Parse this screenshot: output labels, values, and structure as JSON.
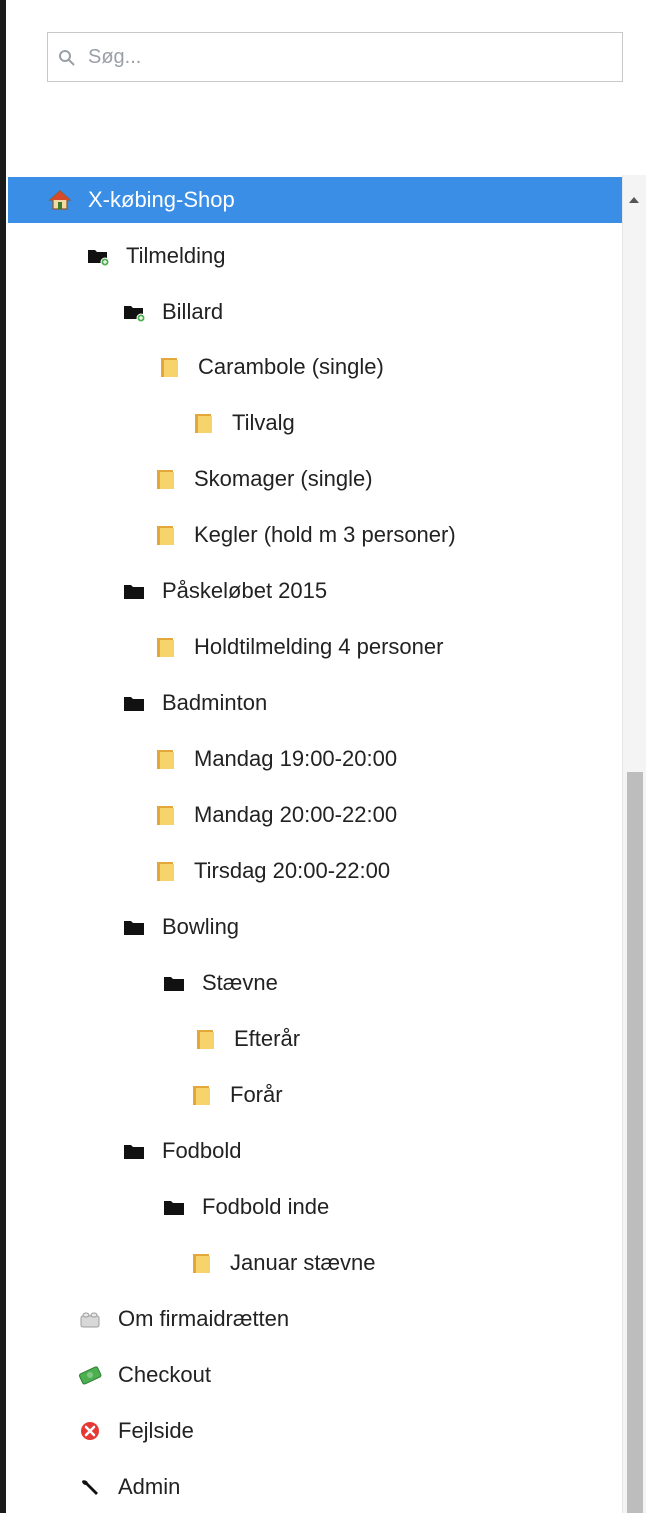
{
  "search": {
    "placeholder": "Søg..."
  },
  "tree": {
    "items": [
      {
        "label": "X-købing-Shop",
        "icon": "home-icon",
        "selected": true
      },
      {
        "label": "Tilmelding",
        "icon": "folder-add-icon"
      },
      {
        "label": "Billard",
        "icon": "folder-add-icon"
      },
      {
        "label": "Carambole (single)",
        "icon": "folder-yellow-icon"
      },
      {
        "label": "Tilvalg",
        "icon": "folder-yellow-icon"
      },
      {
        "label": "Skomager (single)",
        "icon": "folder-yellow-icon"
      },
      {
        "label": "Kegler (hold m 3 personer)",
        "icon": "folder-yellow-icon"
      },
      {
        "label": "Påskeløbet 2015",
        "icon": "folder-black-icon"
      },
      {
        "label": "Holdtilmelding 4 personer",
        "icon": "folder-yellow-icon"
      },
      {
        "label": "Badminton",
        "icon": "folder-black-icon"
      },
      {
        "label": "Mandag 19:00-20:00",
        "icon": "folder-yellow-icon"
      },
      {
        "label": "Mandag 20:00-22:00",
        "icon": "folder-yellow-icon"
      },
      {
        "label": "Tirsdag 20:00-22:00",
        "icon": "folder-yellow-icon"
      },
      {
        "label": "Bowling",
        "icon": "folder-black-icon"
      },
      {
        "label": "Stævne",
        "icon": "folder-black-icon"
      },
      {
        "label": "Efterår",
        "icon": "folder-yellow-icon"
      },
      {
        "label": "Forår",
        "icon": "folder-yellow-icon"
      },
      {
        "label": "Fodbold",
        "icon": "folder-black-icon"
      },
      {
        "label": "Fodbold inde",
        "icon": "folder-black-icon"
      },
      {
        "label": "Januar stævne",
        "icon": "folder-yellow-icon"
      },
      {
        "label": "Om firmaidrætten",
        "icon": "lego-block-icon"
      },
      {
        "label": "Checkout",
        "icon": "money-icon"
      },
      {
        "label": "Fejlside",
        "icon": "error-icon"
      },
      {
        "label": "Admin",
        "icon": "wrench-icon"
      }
    ]
  },
  "colors": {
    "selected_bg": "#3a8ee6",
    "selected_text": "#ffffff",
    "folder_yellow": "#f2c94c",
    "folder_black": "#111111",
    "error_red": "#e53935"
  }
}
